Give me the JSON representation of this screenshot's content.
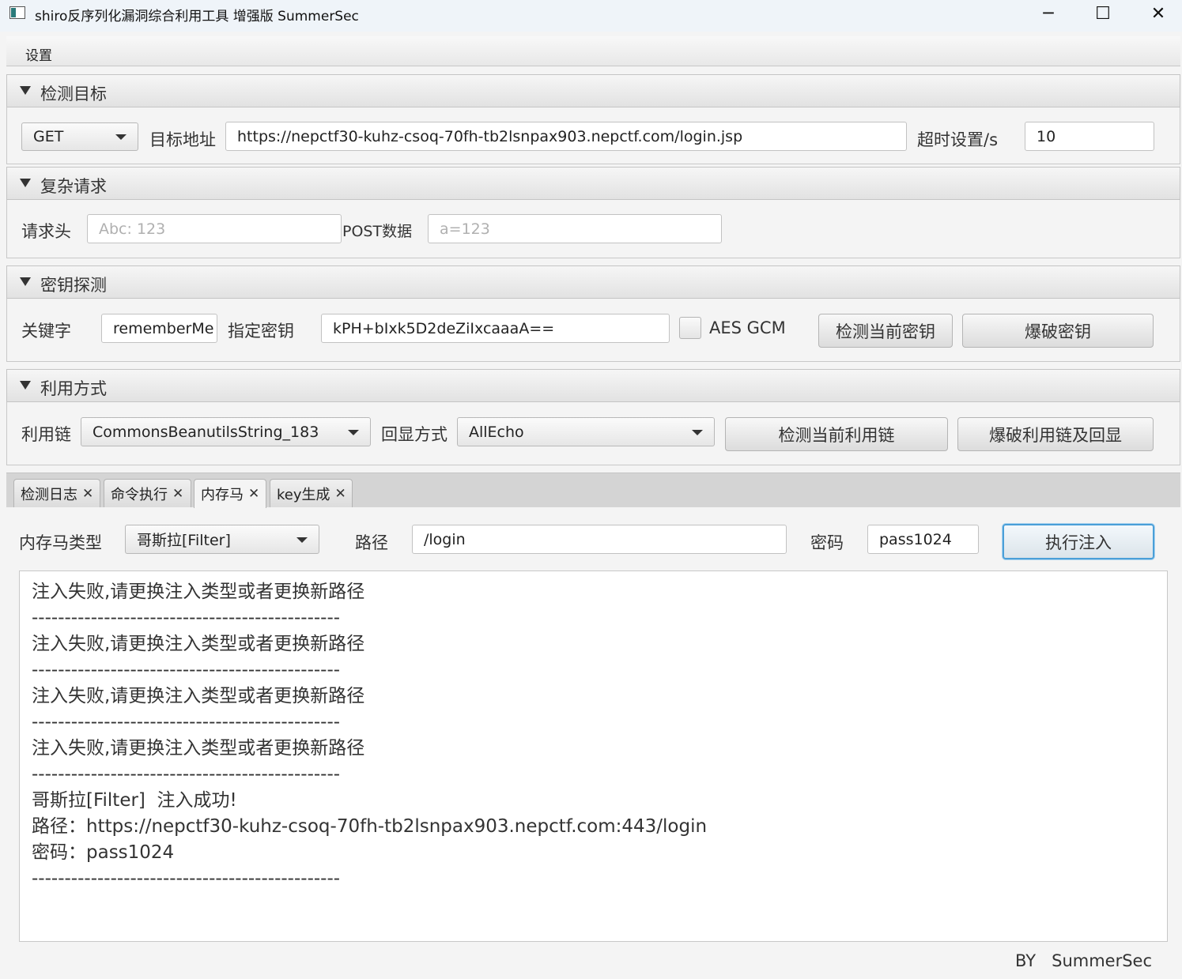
{
  "window": {
    "title": "shiro反序列化漏洞综合利用工具 增强版 SummerSec",
    "minimize": "─",
    "maximize": "☐",
    "close": "✕"
  },
  "menu": {
    "settings": "设置"
  },
  "detect_target": {
    "title": "检测目标",
    "method": "GET",
    "url_label": "目标地址",
    "url": "https://nepctf30-kuhz-csoq-70fh-tb2lsnpax903.nepctf.com/login.jsp",
    "timeout_label": "超时设置/s",
    "timeout": "10"
  },
  "complex_request": {
    "title": "复杂请求",
    "headers_label": "请求头",
    "headers_placeholder": "Abc: 123",
    "post_label": "POST数据",
    "post_placeholder": "a=123"
  },
  "key_detect": {
    "title": "密钥探测",
    "keyword_label": "关键字",
    "keyword": "rememberMe",
    "key_label": "指定密钥",
    "key": "kPH+bIxk5D2deZiIxcaaaA==",
    "aes_gcm_label": "AES GCM",
    "aes_gcm_checked": false,
    "check_key_button": "检测当前密钥",
    "brute_key_button": "爆破密钥"
  },
  "exploit": {
    "title": "利用方式",
    "chain_label": "利用链",
    "chain": "CommonsBeanutilsString_183",
    "echo_label": "回显方式",
    "echo": "AllEcho",
    "check_chain_button": "检测当前利用链",
    "brute_chain_button": "爆破利用链及回显"
  },
  "tabs": [
    {
      "label": "检测日志",
      "close": "✕"
    },
    {
      "label": "命令执行",
      "close": "✕"
    },
    {
      "label": "内存马",
      "close": "✕"
    },
    {
      "label": "key生成",
      "close": "✕"
    }
  ],
  "memshell": {
    "type_label": "内存马类型",
    "type": "哥斯拉[Filter]",
    "path_label": "路径",
    "path": "/login",
    "password_label": "密码",
    "password": "pass1024",
    "inject_button": "执行注入"
  },
  "log": [
    "注入失败,请更换注入类型或者更换新路径",
    "-----------------------------------------------",
    "注入失败,请更换注入类型或者更换新路径",
    "-----------------------------------------------",
    "注入失败,请更换注入类型或者更换新路径",
    "-----------------------------------------------",
    "注入失败,请更换注入类型或者更换新路径",
    "-----------------------------------------------",
    "哥斯拉[Filter]  注入成功!",
    "路径：https://nepctf30-kuhz-csoq-70fh-tb2lsnpax903.nepctf.com:443/login",
    "密码：pass1024",
    "-----------------------------------------------"
  ],
  "footer": "BY   SummerSec"
}
